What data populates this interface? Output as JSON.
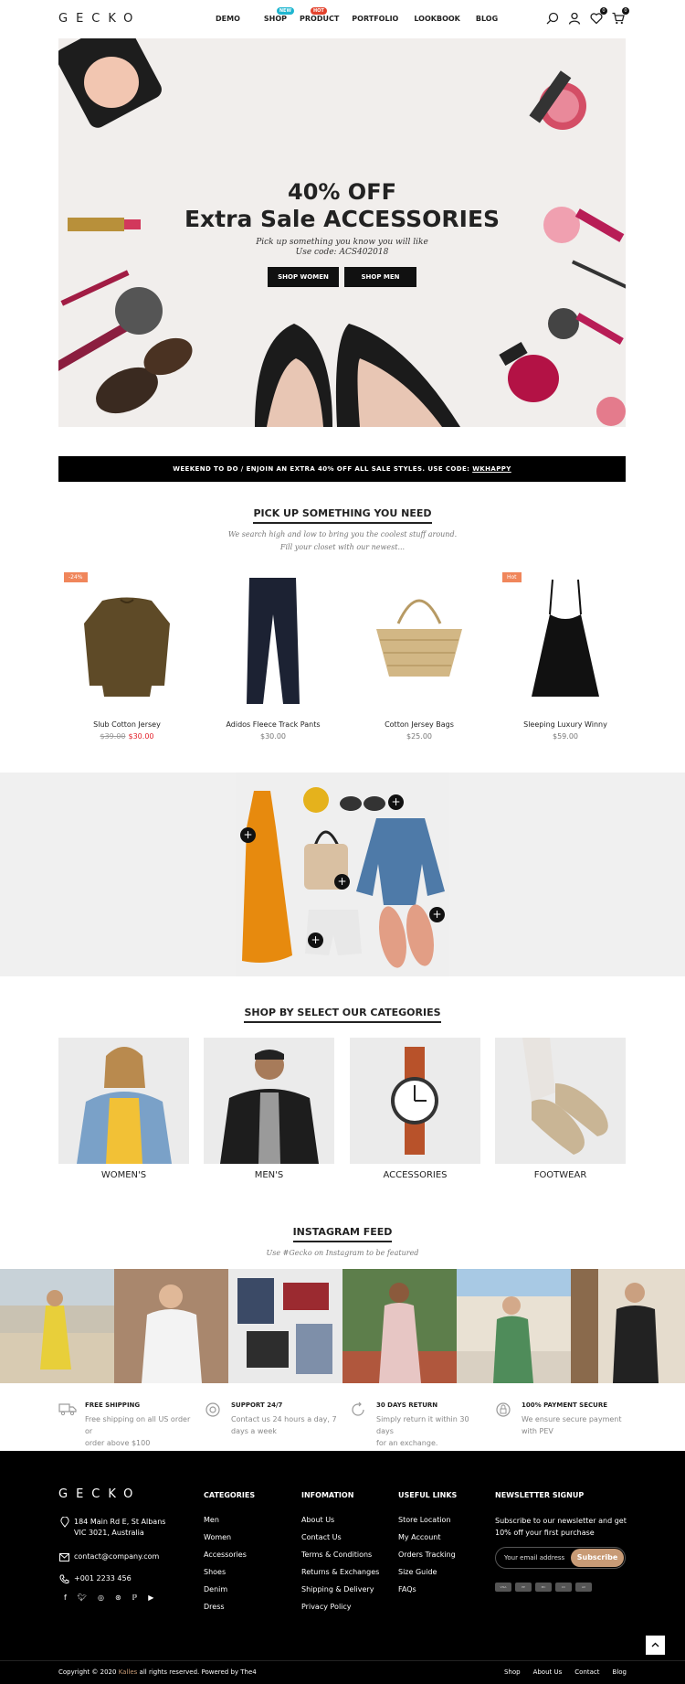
{
  "header": {
    "logo": "GECKO",
    "nav": [
      {
        "label": "DEMO",
        "badge": ""
      },
      {
        "label": "SHOP",
        "badge": "NEW",
        "badge_color": "#1fb6d0"
      },
      {
        "label": "PRODUCT",
        "badge": "HOT",
        "badge_color": "#e3432d"
      },
      {
        "label": "PORTFOLIO",
        "badge": ""
      },
      {
        "label": "LOOKBOOK",
        "badge": ""
      },
      {
        "label": "BLOG",
        "badge": ""
      }
    ],
    "icons": [
      "search-icon",
      "user-icon",
      "wishlist-icon",
      "cart-icon"
    ],
    "wishlist_count": "0",
    "cart_count": "0"
  },
  "hero": {
    "title_line1": "40% OFF",
    "title_line2": "Extra Sale ACCESSORIES",
    "subtitle_line1": "Pick up something you know you will like",
    "subtitle_line2": "Use code: ACS402018",
    "btn_women": "SHOP WOMEN",
    "btn_men": "SHOP MEN"
  },
  "promo": {
    "text": "WEEKEND TO DO / ENJOIN AN EXTRA 40% OFF ALL SALE STYLES. USE CODE: ",
    "code": "WKHAPPY"
  },
  "products_section": {
    "title": "PICK UP SOMETHING YOU NEED",
    "subtitle_line1": "We search high and low to bring you the coolest stuff around.",
    "subtitle_line2": "Fill your closet with our newest..."
  },
  "products": [
    {
      "name": "Slub Cotton Jersey",
      "old_price": "$39.00",
      "price": "$30.00",
      "badge": "-24%"
    },
    {
      "name": "Adidos Fleece Track Pants",
      "old_price": "",
      "price": "$30.00",
      "badge": ""
    },
    {
      "name": "Cotton Jersey Bags",
      "old_price": "",
      "price": "$25.00",
      "badge": ""
    },
    {
      "name": "Sleeping Luxury Winny",
      "old_price": "",
      "price": "$59.00",
      "badge": "Hot"
    }
  ],
  "categories_section": {
    "title": "SHOP BY SELECT OUR CATEGORIES"
  },
  "categories": [
    "WOMEN'S",
    "MEN'S",
    "ACCESSORIES",
    "FOOTWEAR"
  ],
  "instagram": {
    "title": "INSTAGRAM FEED",
    "subtitle": "Use #Gecko on Instagram to be featured"
  },
  "features": [
    {
      "title": "FREE SHIPPING",
      "text_line1": "Free shipping on all US order or",
      "text_line2": "order above $100",
      "icon": "truck-icon"
    },
    {
      "title": "SUPPORT 24/7",
      "text_line1": "Contact us 24 hours a day, 7",
      "text_line2": "days a week",
      "icon": "support-icon"
    },
    {
      "title": "30 DAYS RETURN",
      "text_line1": "Simply return it within 30 days",
      "text_line2": "for an exchange.",
      "icon": "return-icon"
    },
    {
      "title": "100% PAYMENT SECURE",
      "text_line1": "We ensure secure payment",
      "text_line2": "with PEV",
      "icon": "secure-icon"
    }
  ],
  "footer": {
    "logo": "GECKO",
    "address_line1": "184 Main Rd E, St Albans",
    "address_line2": "VIC 3021, Australia",
    "email": "contact@company.com",
    "phone": "+001 2233 456",
    "social_icons": [
      "facebook-icon",
      "twitter-icon",
      "instagram-icon",
      "dribbble-icon",
      "pinterest-icon",
      "youtube-icon"
    ],
    "categories_title": "CATEGORIES",
    "categories": [
      "Men",
      "Women",
      "Accessories",
      "Shoes",
      "Denim",
      "Dress"
    ],
    "info_title": "INFOMATION",
    "info": [
      "About Us",
      "Contact Us",
      "Terms & Conditions",
      "Returns & Exchanges",
      "Shipping & Delivery",
      "Privacy Policy"
    ],
    "links_title": "USEFUL LINKS",
    "links": [
      "Store Location",
      "My Account",
      "Orders Tracking",
      "Size Guide",
      "FAQs"
    ],
    "newsletter_title": "NEWSLETTER SIGNUP",
    "newsletter_text": "Subscribe to our newsletter and get 10% off your first purchase",
    "newsletter_placeholder": "Your email address",
    "newsletter_btn": "Subscribe",
    "payment_icons": [
      "visa-icon",
      "paypal-icon",
      "card-icon",
      "card-icon",
      "amex-icon"
    ],
    "copyright_pre": "Copyright © 2020 ",
    "copyright_brand": "Kalles",
    "copyright_post": " all rights reserved. Powered by The4",
    "bottom_links": [
      "Shop",
      "About Us",
      "Contact",
      "Blog"
    ],
    "accent": "#c89b76"
  }
}
